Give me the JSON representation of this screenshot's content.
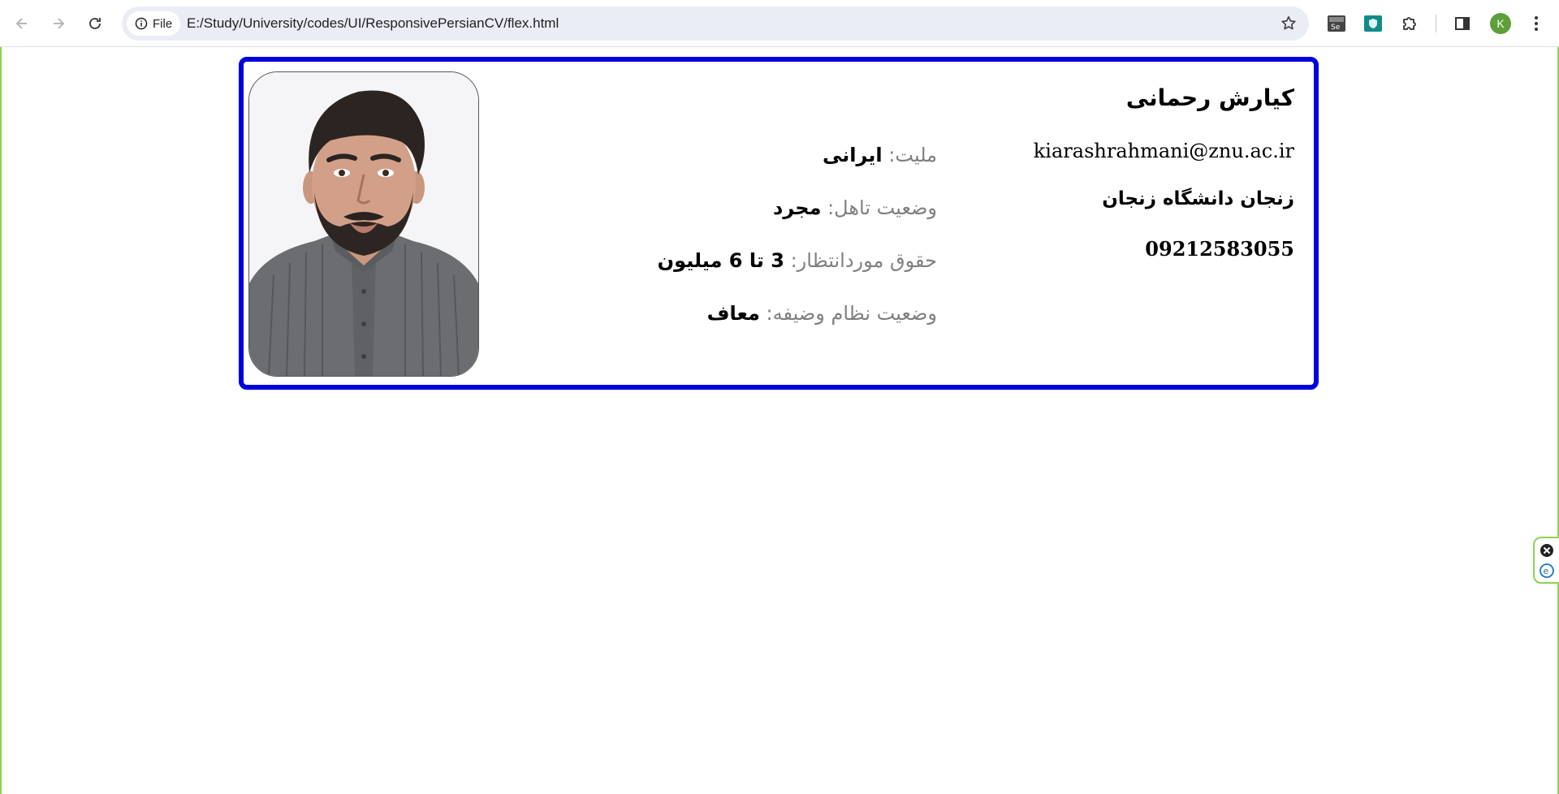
{
  "browser": {
    "site_chip_label": "File",
    "url": "E:/Study/University/codes/UI/ResponsivePersianCV/flex.html",
    "profile_initial": "K"
  },
  "cv": {
    "name": "کیارش رحمانی",
    "email": "kiarashrahmani@znu.ac.ir",
    "address": "زنجان دانشگاه زنجان",
    "phone": "09212583055",
    "details": [
      {
        "label": "ملیت:",
        "value": "ایرانی"
      },
      {
        "label": "وضعیت تاهل:",
        "value": "مجرد"
      },
      {
        "label": "حقوق موردانتظار:",
        "value": "3 تا 6 میلیون"
      },
      {
        "label": "وضعیت نظام وضیفه:",
        "value": "معاف"
      }
    ]
  },
  "colors": {
    "card_border": "#0000dd",
    "label_gray": "#808080",
    "viewport_border": "#8fd14f",
    "profile_green": "#5d9f3a"
  }
}
